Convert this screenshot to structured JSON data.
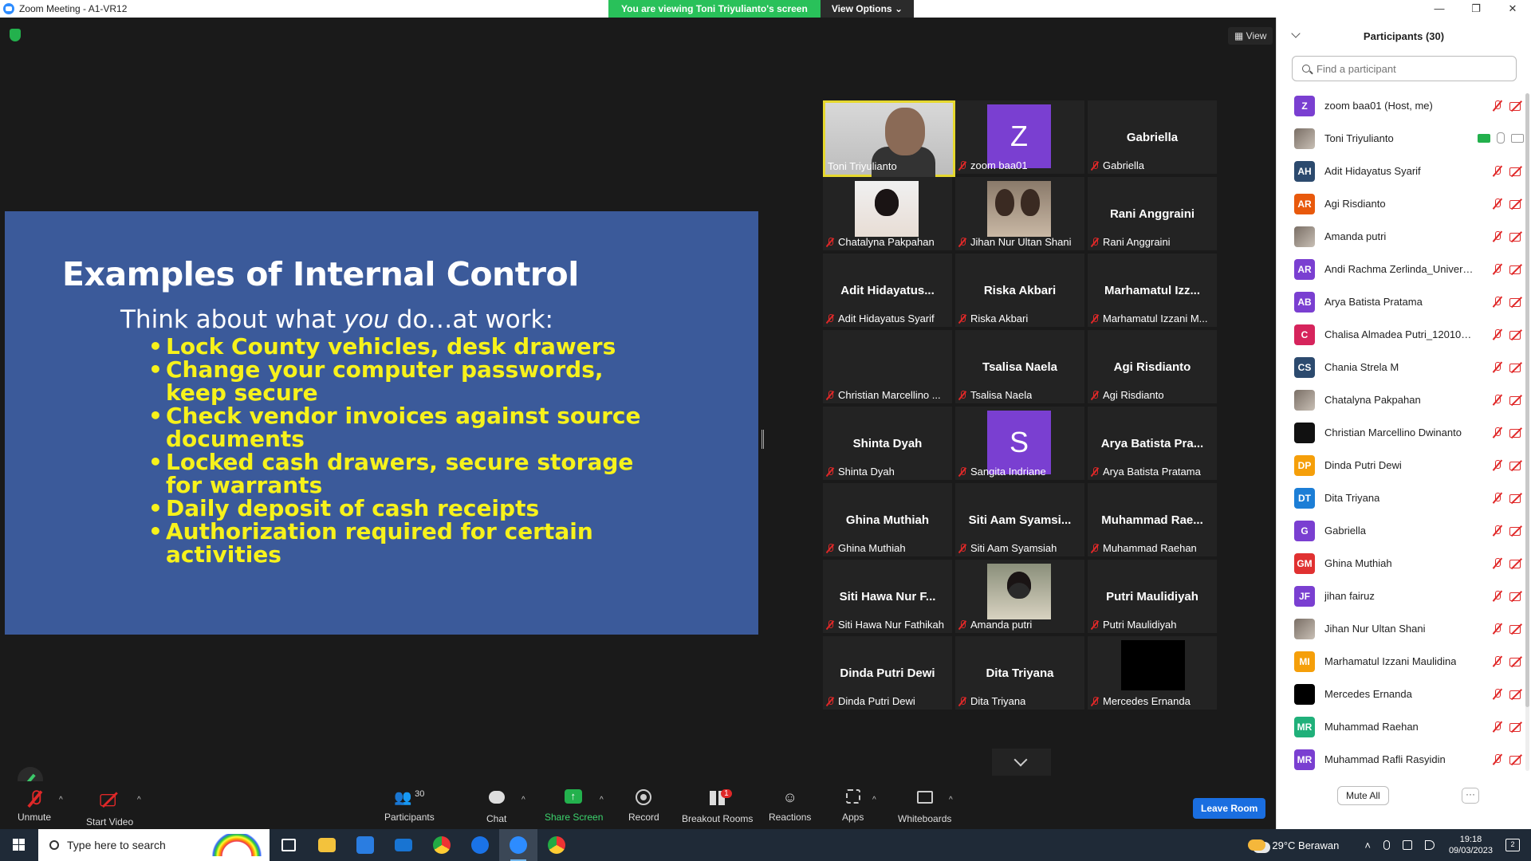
{
  "window": {
    "title": "Zoom Meeting - A1-VR12",
    "controls": [
      "—",
      "❐",
      "✕"
    ]
  },
  "banner": {
    "viewing": "You are viewing Toni Triyulianto's screen",
    "view_options": "View Options"
  },
  "view_button": "View",
  "slide": {
    "title": "Examples of Internal Control",
    "subtitle_pre": "Think about what ",
    "subtitle_em": "you",
    "subtitle_post": " do…at work:",
    "bullets": [
      "Lock County vehicles, desk drawers",
      "Change your computer passwords, keep secure",
      "Check vendor invoices against source documents",
      "Locked cash drawers, secure storage for warrants",
      "Daily deposit of cash receipts",
      "Authorization required for certain activities"
    ]
  },
  "gallery": {
    "tiles": [
      {
        "caption": "Toni Triyulianto",
        "kind": "speaker"
      },
      {
        "caption": "zoom baa01",
        "kind": "avatar",
        "letter": "Z",
        "color": "#7a3fd1"
      },
      {
        "caption": "Gabriella",
        "kind": "name",
        "big": "Gabriella"
      },
      {
        "caption": "Chatalyna Pakpahan",
        "kind": "photo"
      },
      {
        "caption": "Jihan Nur Ultan Shani",
        "kind": "photo2"
      },
      {
        "caption": "Rani Anggraini",
        "kind": "name",
        "big": "Rani Anggraini"
      },
      {
        "caption": "Adit Hidayatus Syarif",
        "kind": "name",
        "big": "Adit  Hidayatus..."
      },
      {
        "caption": "Riska Akbari",
        "kind": "name",
        "big": "Riska Akbari"
      },
      {
        "caption": "Marhamatul Izzani M...",
        "kind": "name",
        "big": "Marhamatul  Izz..."
      },
      {
        "caption": "Christian Marcellino ...",
        "kind": "blank"
      },
      {
        "caption": "Tsalisa Naela",
        "kind": "name",
        "big": "Tsalisa Naela"
      },
      {
        "caption": "Agi Risdianto",
        "kind": "name",
        "big": "Agi Risdianto"
      },
      {
        "caption": "Shinta Dyah",
        "kind": "name",
        "big": "Shinta Dyah"
      },
      {
        "caption": "Sangita Indriane",
        "kind": "avatar",
        "letter": "S",
        "color": "#7a3fd1"
      },
      {
        "caption": "Arya Batista Pratama",
        "kind": "name",
        "big": "Arya Batista Pra..."
      },
      {
        "caption": "Ghina Muthiah",
        "kind": "name",
        "big": "Ghina Muthiah"
      },
      {
        "caption": "Siti Aam Syamsiah",
        "kind": "name",
        "big": "Siti Aam  Syamsi..."
      },
      {
        "caption": "Muhammad Raehan",
        "kind": "name",
        "big": "Muhammad  Rae..."
      },
      {
        "caption": "Siti Hawa Nur Fathikah",
        "kind": "name",
        "big": "Siti Hawa Nur F..."
      },
      {
        "caption": "Amanda putri",
        "kind": "photo3"
      },
      {
        "caption": "Putri Maulidiyah",
        "kind": "name",
        "big": "Putri Maulidiyah"
      },
      {
        "caption": "Dinda Putri Dewi",
        "kind": "name",
        "big": "Dinda Putri Dewi"
      },
      {
        "caption": "Dita Triyana",
        "kind": "name",
        "big": "Dita Triyana"
      },
      {
        "caption": "Mercedes Ernanda",
        "kind": "black"
      }
    ]
  },
  "toolbar": {
    "unmute": "Unmute",
    "start_video": "Start Video",
    "participants": "Participants",
    "participants_count": "30",
    "chat": "Chat",
    "share_screen": "Share Screen",
    "record": "Record",
    "breakout_rooms": "Breakout Rooms",
    "breakout_badge": "1",
    "reactions": "Reactions",
    "apps": "Apps",
    "whiteboards": "Whiteboards",
    "leave_room": "Leave Room"
  },
  "participants_panel": {
    "title": "Participants (30)",
    "search_placeholder": "Find a participant",
    "mute_all": "Mute All",
    "more": "···",
    "items": [
      {
        "initials": "Z",
        "name": "zoom baa01 (Host, me)",
        "color": "#7a3fd1",
        "icons": "muted"
      },
      {
        "initials": "",
        "name": "Toni Triyulianto",
        "color": "",
        "icons": "sharing",
        "photo": true
      },
      {
        "initials": "AH",
        "name": "Adit Hidayatus Syarif",
        "color": "#2c4a6e",
        "icons": "muted"
      },
      {
        "initials": "AR",
        "name": "Agi Risdianto",
        "color": "#e8590c",
        "icons": "muted"
      },
      {
        "initials": "",
        "name": "Amanda putri",
        "color": "",
        "icons": "muted",
        "photo": true
      },
      {
        "initials": "AR",
        "name": "Andi Rachma Zerlinda_Universit...",
        "color": "#7a3fd1",
        "icons": "muted"
      },
      {
        "initials": "AB",
        "name": "Arya Batista Pratama",
        "color": "#7a3fd1",
        "icons": "muted"
      },
      {
        "initials": "C",
        "name": "Chalisa Almadea Putri_1201002...",
        "color": "#d6245c",
        "icons": "muted"
      },
      {
        "initials": "CS",
        "name": "Chania Strela M",
        "color": "#2c4a6e",
        "icons": "muted"
      },
      {
        "initials": "",
        "name": "Chatalyna Pakpahan",
        "color": "",
        "icons": "muted",
        "photo": true
      },
      {
        "initials": "",
        "name": "Christian Marcellino Dwinanto",
        "color": "#111111",
        "icons": "muted"
      },
      {
        "initials": "DP",
        "name": "Dinda Putri Dewi",
        "color": "#f59f0a",
        "icons": "muted"
      },
      {
        "initials": "DT",
        "name": "Dita Triyana",
        "color": "#1c7ed6",
        "icons": "muted"
      },
      {
        "initials": "G",
        "name": "Gabriella",
        "color": "#7a3fd1",
        "icons": "muted"
      },
      {
        "initials": "GM",
        "name": "Ghina Muthiah",
        "color": "#e03131",
        "icons": "muted"
      },
      {
        "initials": "JF",
        "name": "jihan fairuz",
        "color": "#7a3fd1",
        "icons": "muted"
      },
      {
        "initials": "",
        "name": "Jihan Nur Ultan Shani",
        "color": "",
        "icons": "muted",
        "photo": true
      },
      {
        "initials": "MI",
        "name": "Marhamatul Izzani Maulidina",
        "color": "#f59f0a",
        "icons": "muted"
      },
      {
        "initials": "",
        "name": "Mercedes Ernanda",
        "color": "#000000",
        "icons": "muted"
      },
      {
        "initials": "MR",
        "name": "Muhammad Raehan",
        "color": "#20b07a",
        "icons": "muted"
      },
      {
        "initials": "MR",
        "name": "Muhammad Rafli Rasyidin",
        "color": "#7a3fd1",
        "icons": "muted"
      }
    ]
  },
  "taskbar": {
    "search_placeholder": "Type here to search",
    "weather": "29°C  Berawan",
    "time": "19:18",
    "date": "09/03/2023",
    "notification_count": "2"
  }
}
